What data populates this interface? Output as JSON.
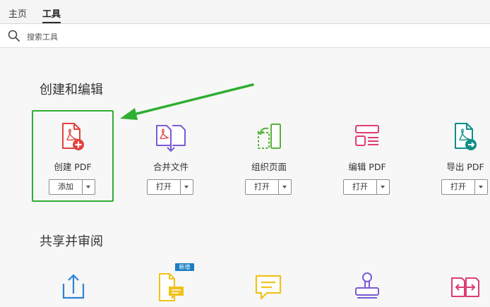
{
  "tabs": [
    {
      "label": "主页",
      "active": false
    },
    {
      "label": "工具",
      "active": true
    }
  ],
  "search": {
    "placeholder": "搜索工具",
    "icon": "search-icon"
  },
  "sections": [
    {
      "title": "创建和编辑",
      "tools": [
        {
          "name": "创建 PDF",
          "button": "添加",
          "icon": "create-pdf-icon",
          "highlighted": true
        },
        {
          "name": "合并文件",
          "button": "打开",
          "icon": "combine-files-icon"
        },
        {
          "name": "组织页面",
          "button": "打开",
          "icon": "organize-pages-icon"
        },
        {
          "name": "编辑 PDF",
          "button": "打开",
          "icon": "edit-pdf-icon"
        },
        {
          "name": "导出 PDF",
          "button": "打开",
          "icon": "export-pdf-icon"
        }
      ]
    },
    {
      "title": "共享并审阅",
      "tools": [
        {
          "icon": "share-icon"
        },
        {
          "icon": "comment-icon",
          "badge": "新增"
        },
        {
          "icon": "send-for-comments-icon"
        },
        {
          "icon": "stamp-icon"
        },
        {
          "icon": "compare-files-icon"
        }
      ]
    }
  ],
  "colors": {
    "highlight": "#2fae33",
    "arrow": "#2fae33",
    "pdf_red": "#e0423f",
    "purple": "#7b5bd6",
    "green": "#59b33a",
    "pink": "#dd3d74",
    "teal": "#0f8f86",
    "blue": "#2d83d8",
    "yellow": "#f0c21b",
    "badge_blue": "#1d7ec2"
  }
}
